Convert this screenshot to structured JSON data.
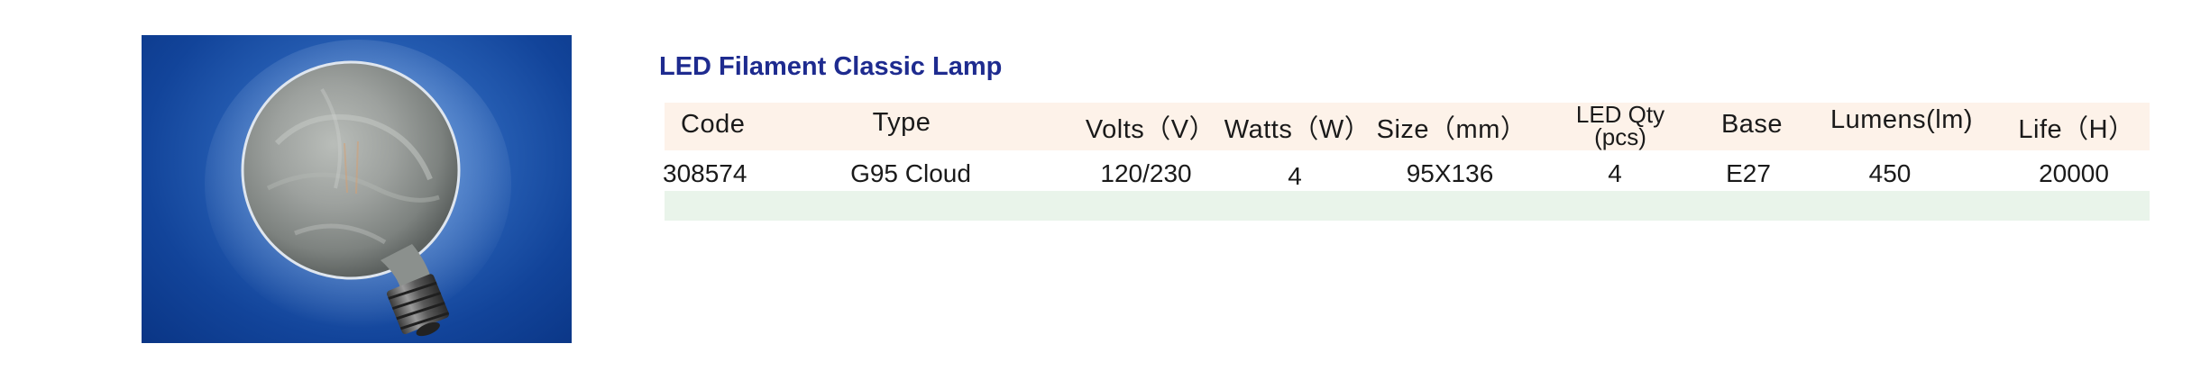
{
  "product_image": {
    "alt": "G95 Cloud filament globe bulb",
    "background_color": "#1a4fa6"
  },
  "title": "LED Filament Classic Lamp",
  "colors": {
    "title": "#1e2b8f",
    "header_band": "#fdf2e9",
    "alt_row_band": "#e9f4ea"
  },
  "table": {
    "headers": {
      "code": "Code",
      "type": "Type",
      "volts": "Volts（V）",
      "watts": "Watts（W）",
      "size": "Size（mm）",
      "led_qty_line1": "LED Qty",
      "led_qty_line2": "(pcs)",
      "base": "Base",
      "lumens": "Lumens(lm)",
      "life": "Life（H）"
    },
    "rows": [
      {
        "code": "308574",
        "type": "G95 Cloud",
        "volts": "120/230",
        "watts": "4",
        "size": "95X136",
        "led_qty": "4",
        "base": "E27",
        "lumens": "450",
        "life": "20000"
      }
    ]
  }
}
